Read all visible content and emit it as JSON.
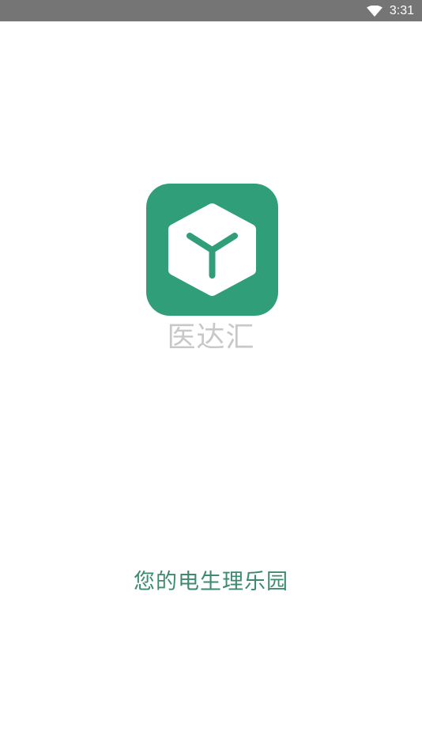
{
  "status_bar": {
    "time": "3:31",
    "wifi_icon": "wifi-icon"
  },
  "splash": {
    "logo_icon": "cube-logo-icon",
    "app_name": "医达汇",
    "slogan": "您的电生理乐园"
  },
  "colors": {
    "status_bar_bg": "#757575",
    "brand_green": "#2f9e79",
    "app_name_text": "#c8c8c8",
    "slogan_text": "#3e8a70",
    "background": "#ffffff"
  }
}
